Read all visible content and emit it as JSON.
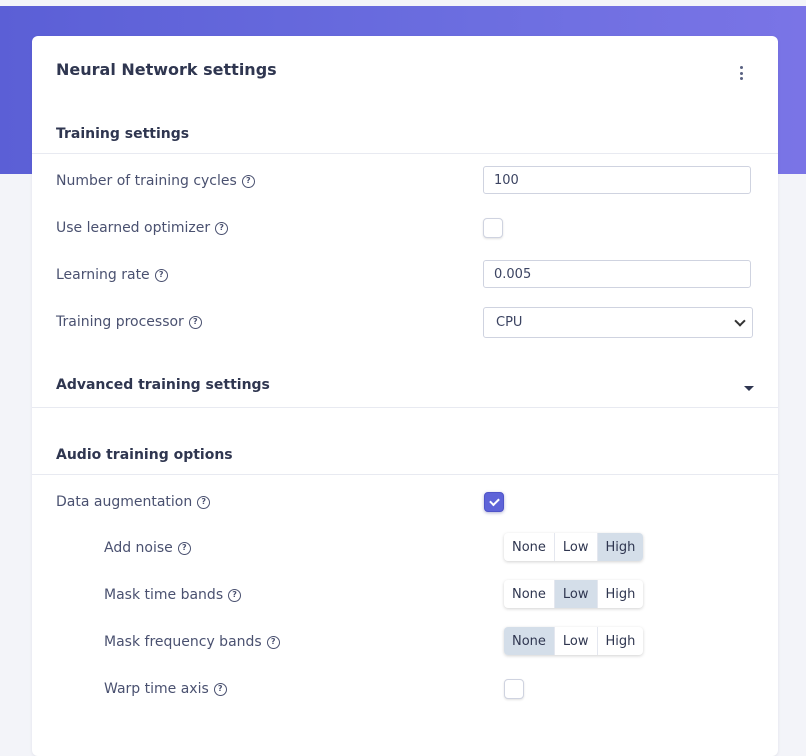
{
  "card": {
    "title": "Neural Network settings"
  },
  "sections": {
    "training": "Training settings",
    "advanced": "Advanced training settings",
    "audio": "Audio training options"
  },
  "training": {
    "cycles": {
      "label": "Number of training cycles",
      "value": "100"
    },
    "optimizer": {
      "label": "Use learned optimizer",
      "checked": false
    },
    "learning_rate": {
      "label": "Learning rate",
      "value": "0.005"
    },
    "processor": {
      "label": "Training processor",
      "value": "CPU"
    }
  },
  "audio": {
    "augmentation": {
      "label": "Data augmentation",
      "checked": true
    },
    "options": [
      "None",
      "Low",
      "High"
    ],
    "noise": {
      "label": "Add noise",
      "selected": "High"
    },
    "time_bands": {
      "label": "Mask time bands",
      "selected": "Low"
    },
    "freq_bands": {
      "label": "Mask frequency bands",
      "selected": "None"
    },
    "warp": {
      "label": "Warp time axis",
      "checked": false
    }
  },
  "help_glyph": "?",
  "icons": [
    "help-icon",
    "kebab-menu-icon",
    "chevron-down-icon",
    "caret-down-icon",
    "checkmark-icon"
  ],
  "colors": {
    "accent": "#5e63d8",
    "header": "#6c6ee0",
    "segment_active": "#d4dee9"
  }
}
